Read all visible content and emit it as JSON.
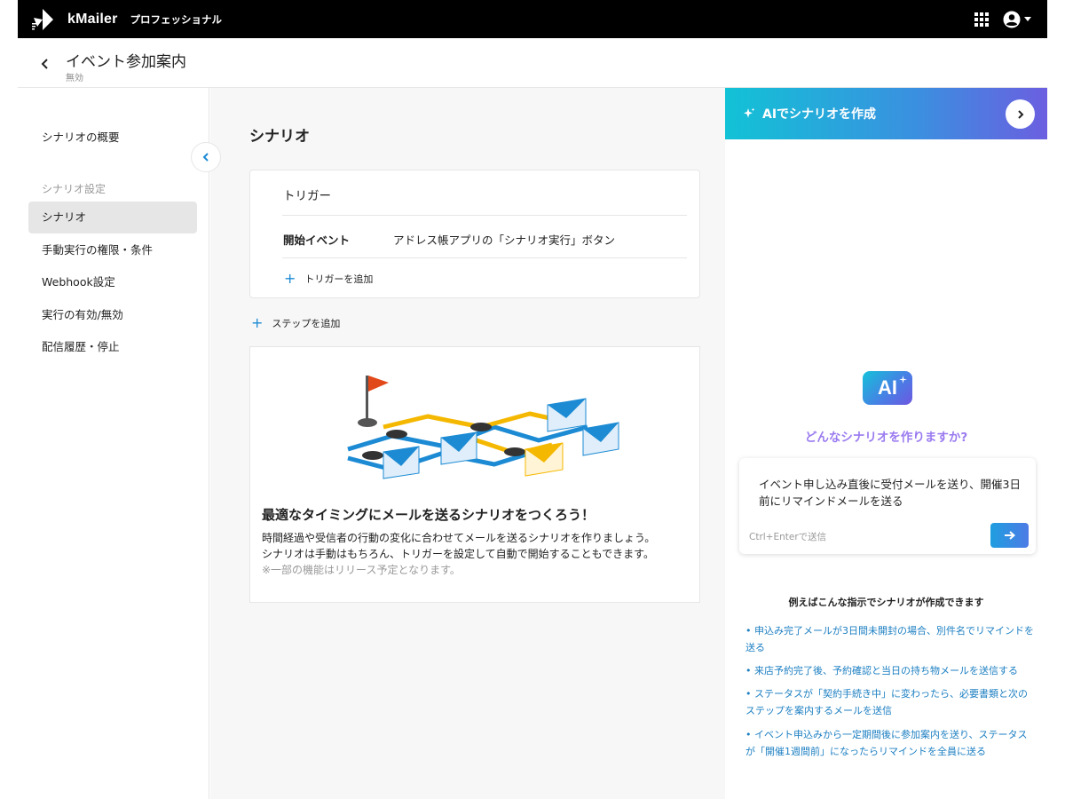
{
  "app": {
    "brand": "kMailer",
    "edition": "プロフェッショナル",
    "logo_icon": "kintone-kmailer-logo",
    "apps_icon": "grid-icon",
    "account_icon": "account-circle-icon"
  },
  "header": {
    "title": "イベント参加案内",
    "status": "無効"
  },
  "sidebar": {
    "overview": "シナリオの概要",
    "section_heading": "シナリオ設定",
    "items": [
      {
        "label": "シナリオ",
        "active": true
      },
      {
        "label": "手動実行の権限・条件",
        "active": false
      },
      {
        "label": "Webhook設定",
        "active": false
      },
      {
        "label": "実行の有効/無効",
        "active": false
      },
      {
        "label": "配信履歴・停止",
        "active": false
      }
    ]
  },
  "main": {
    "title": "シナリオ",
    "trigger": {
      "title": "トリガー",
      "event_label": "開始イベント",
      "event_value": "アドレス帳アプリの「シナリオ実行」ボタン",
      "add_trigger": "トリガーを追加"
    },
    "add_step": "ステップを追加",
    "empty_state": {
      "title": "最適なタイミングにメールを送るシナリオをつくろう！",
      "line1": "時間経過や受信者の行動の変化に合わせてメールを送るシナリオを作りましょう。",
      "line2": "シナリオは手動はもちろん、トリガーを設定して自動で開始することもできます。",
      "note": "※一部の機能はリリース予定となります。"
    }
  },
  "ai": {
    "banner_label": "AIでシナリオを作成",
    "badge": "AI",
    "question": "どんなシナリオを作りますか?",
    "prompt_value": "イベント申し込み直後に受付メールを送り、開催3日前にリマインドメールを送る",
    "hint": "Ctrl+Enterで送信",
    "examples_title": "例えばこんな指示でシナリオが作成できます",
    "examples": [
      "• 申込み完了メールが3日間未開封の場合、別件名でリマインドを送る",
      "• 来店予約完了後、予約確認と当日の持ち物メールを送信する",
      "• ステータスが「契約手続き中」に変わったら、必要書類と次のステップを案内するメールを送信",
      "• イベント申込みから一定期間後に参加案内を送り、ステータスが「開催1週間前」になったらリマインドを全員に送る"
    ],
    "colors": {
      "accent": "#1c8bd4",
      "question": "#9a7bf0"
    }
  }
}
